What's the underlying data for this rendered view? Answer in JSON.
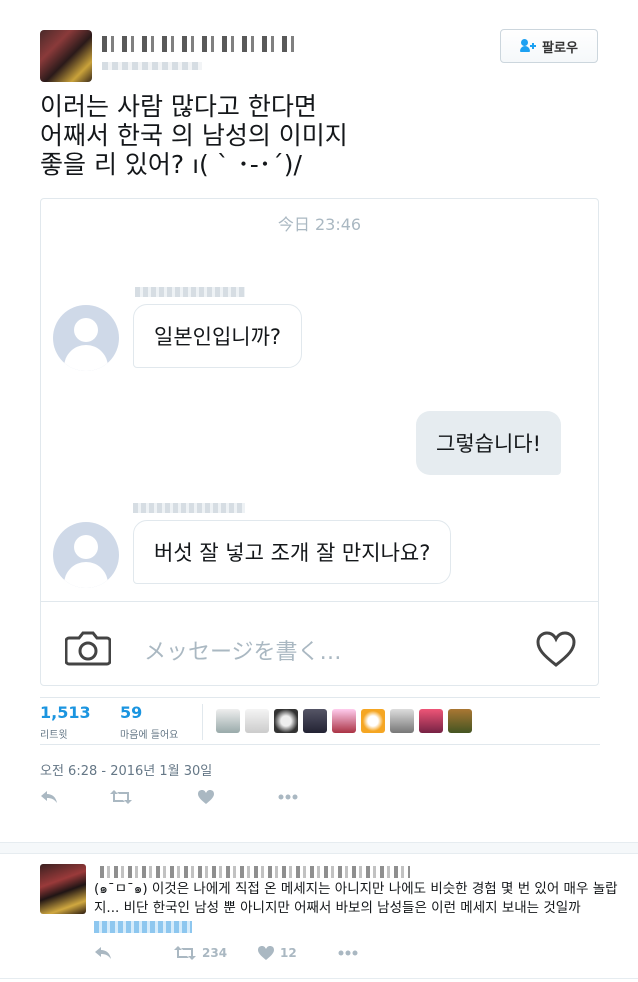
{
  "header": {
    "follow_label": "팔로우",
    "colors": {
      "accent": "#1da1f2",
      "link": "#1b95e0"
    }
  },
  "tweet": {
    "text": "이러는 사람 많다고 한다면\n어째서 한국 의 남성의 이미지\n좋을 리 있어? ı( ` ･-･´)/"
  },
  "dm_card": {
    "time": "今日 23:46",
    "messages": [
      {
        "direction": "in",
        "text": "일본인입니까?"
      },
      {
        "direction": "out",
        "text": "그렇습니다!"
      },
      {
        "direction": "in",
        "text": "버섯 잘 넣고 조개 잘 만지나요?"
      }
    ],
    "compose_placeholder": "メッセージを書く…",
    "icons": [
      "camera-icon",
      "heart-icon",
      "default-avatar-icon"
    ]
  },
  "stats": {
    "retweets": {
      "count": "1,513",
      "label": "리트윗"
    },
    "likes": {
      "count": "59",
      "label": "마음에 들어요"
    },
    "liker_avatar_count": 10
  },
  "date": "오전 6:28 - 2016년 1월 30일",
  "actions": {
    "icons": [
      "reply-icon",
      "retweet-icon",
      "heart-icon",
      "more-icon"
    ]
  },
  "reply": {
    "text": "(๑¯ㅁ¯๑) 이것은 나에게 직접 온 메세지는 아니지만 나에도 비슷한 경험 몇 번 있어 매우 놀랍지... 비단 한국인 남성 뿐 아니지만 어째서 바보의 남성들은 이런 메세지 보내는 것일까",
    "retweet_count": "234",
    "like_count": "12"
  }
}
